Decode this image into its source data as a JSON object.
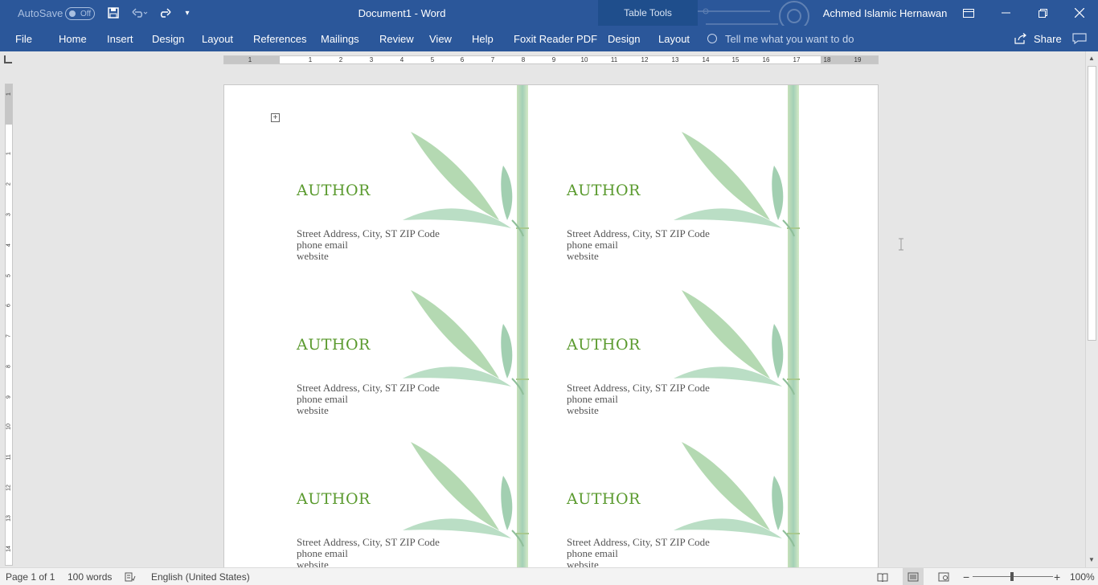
{
  "titlebar": {
    "autosave_label": "AutoSave",
    "autosave_state": "Off",
    "doc_title": "Document1  -  Word",
    "table_tools": "Table Tools",
    "user": "Achmed Islamic Hernawan",
    "icons": [
      "save-icon",
      "undo-icon",
      "redo-icon",
      "customize-qat-icon",
      "ribbon-display-icon",
      "minimize-icon",
      "restore-icon",
      "close-icon"
    ]
  },
  "ribbon": {
    "tabs": [
      "File",
      "Home",
      "Insert",
      "Design",
      "Layout",
      "References",
      "Mailings",
      "Review",
      "View",
      "Help",
      "Foxit Reader PDF",
      "Design",
      "Layout"
    ],
    "tell_me": "Tell me what you want to do",
    "share": "Share"
  },
  "ruler": {
    "h_ticks": [
      "1",
      "1",
      "2",
      "3",
      "4",
      "5",
      "6",
      "7",
      "8",
      "9",
      "10",
      "11",
      "12",
      "13",
      "14",
      "15",
      "16",
      "17",
      "18",
      "19"
    ],
    "v_ticks": [
      "1",
      "1",
      "2",
      "3",
      "4",
      "5",
      "6",
      "7",
      "8",
      "9",
      "10",
      "11",
      "12",
      "13",
      "14"
    ]
  },
  "document": {
    "cards": [
      {
        "author": "AUTHOR",
        "address": "Street Address, City, ST ZIP Code",
        "phone_email": "phone email",
        "website": "website"
      },
      {
        "author": "AUTHOR",
        "address": "Street Address, City, ST ZIP Code",
        "phone_email": "phone email",
        "website": "website"
      },
      {
        "author": "AUTHOR",
        "address": "Street Address, City, ST ZIP Code",
        "phone_email": "phone email",
        "website": "website"
      },
      {
        "author": "AUTHOR",
        "address": "Street Address, City, ST ZIP Code",
        "phone_email": "phone email",
        "website": "website"
      },
      {
        "author": "AUTHOR",
        "address": "Street Address, City, ST ZIP Code",
        "phone_email": "phone email",
        "website": "website"
      },
      {
        "author": "AUTHOR",
        "address": "Street Address, City, ST ZIP Code",
        "phone_email": "phone email",
        "website": "website"
      }
    ]
  },
  "statusbar": {
    "page": "Page 1 of 1",
    "words": "100 words",
    "language": "English (United States)",
    "zoom": "100%"
  },
  "colors": {
    "ribbon": "#2b579a",
    "author_green": "#5a9a2e",
    "bamboo": "#9cc9a6"
  }
}
